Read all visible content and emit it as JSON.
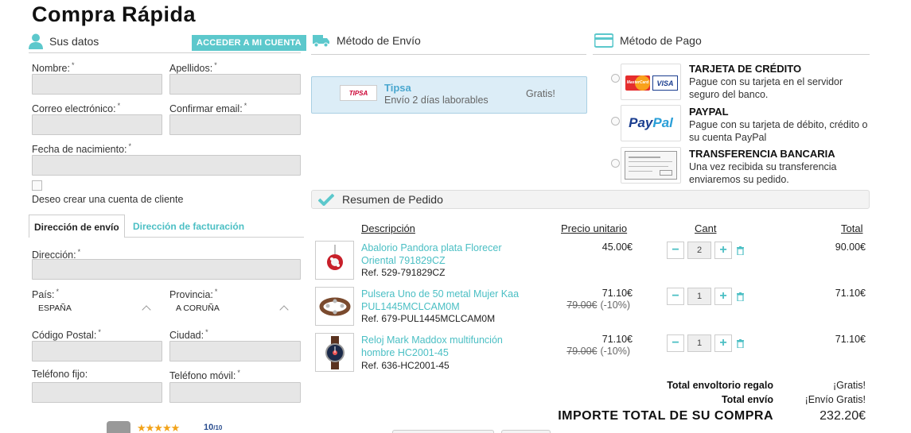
{
  "page": {
    "title": "Compra Rápida"
  },
  "customer": {
    "section_title": "Sus datos",
    "login_button": "ACCEDER A MI CUENTA",
    "fields": {
      "nombre": "Nombre:",
      "apellidos": "Apellidos:",
      "email": "Correo electrónico:",
      "confirm_email": "Confirmar email:",
      "birth": "Fecha de nacimiento:",
      "required_mark": "*"
    },
    "create_account": "Deseo crear una cuenta de cliente"
  },
  "address": {
    "tabs": [
      "Dirección de envío",
      "Dirección de facturación"
    ],
    "fields": {
      "direccion": "Dirección:",
      "pais": "País:",
      "provincia": "Provincia:",
      "cp": "Código Postal:",
      "ciudad": "Ciudad:",
      "telefono": "Teléfono fijo:",
      "movil": "Teléfono móvil:"
    },
    "pais_value": "ESPAÑA",
    "provincia_value": "A CORUÑA"
  },
  "shipping": {
    "section_title": "Método de Envío",
    "carrier": "Tipsa",
    "carrier_logo": "TIPSA",
    "description": "Envío 2 días laborables",
    "price": "Gratis!"
  },
  "payment": {
    "section_title": "Método de Pago",
    "methods": [
      {
        "title": "TARJETA DE CRÉDITO",
        "desc": "Pague con su tarjeta en el servidor seguro del banco."
      },
      {
        "title": "PAYPAL",
        "desc": "Pague con su tarjeta de débito, crédito o su cuenta PayPal"
      },
      {
        "title": "TRANSFERENCIA BANCARIA",
        "desc": "Una vez recibida su transferencia enviaremos su pedido."
      }
    ],
    "logos": {
      "visa": "VISA",
      "mastercard": "MasterCard",
      "paypal_a": "Pay",
      "paypal_b": "Pal"
    }
  },
  "order": {
    "section_title": "Resumen de Pedido",
    "headers": {
      "desc": "Descripción",
      "unit": "Precio unitario",
      "qty": "Cant",
      "total": "Total"
    },
    "items": [
      {
        "name": "Abalorio Pandora plata Florecer Oriental 791829CZ",
        "ref": "Ref. 529-791829CZ",
        "price": "45.00€",
        "old_price": "",
        "discount": "",
        "qty": "2",
        "total": "90.00€"
      },
      {
        "name": "Pulsera Uno de 50 metal Mujer Kaa PUL1445MCLCAM0M",
        "ref": "Ref. 679-PUL1445MCLCAM0M",
        "price": "71.10€",
        "old_price": "79.00€",
        "discount": "(-10%)",
        "qty": "1",
        "total": "71.10€"
      },
      {
        "name": "Reloj Mark Maddox multifunción hombre HC2001-45",
        "ref": "Ref. 636-HC2001-45",
        "price": "71.10€",
        "old_price": "79.00€",
        "discount": "(-10%)",
        "qty": "1",
        "total": "71.10€"
      }
    ],
    "qty_minus": "−",
    "qty_plus": "+",
    "gift_label": "Total envoltorio regalo",
    "gift_value": "¡Gratis!",
    "ship_label": "Total envío",
    "ship_value": "¡Envío Gratis!",
    "grand_label": "IMPORTE TOTAL DE SU COMPRA",
    "grand_value": "232.20€"
  },
  "rating": {
    "stars": 5,
    "score": "10",
    "max": "/10"
  },
  "colors": {
    "accent": "#5cc8cc",
    "ship_box": "#dcedf7",
    "input_bg": "#e6e6e6"
  }
}
